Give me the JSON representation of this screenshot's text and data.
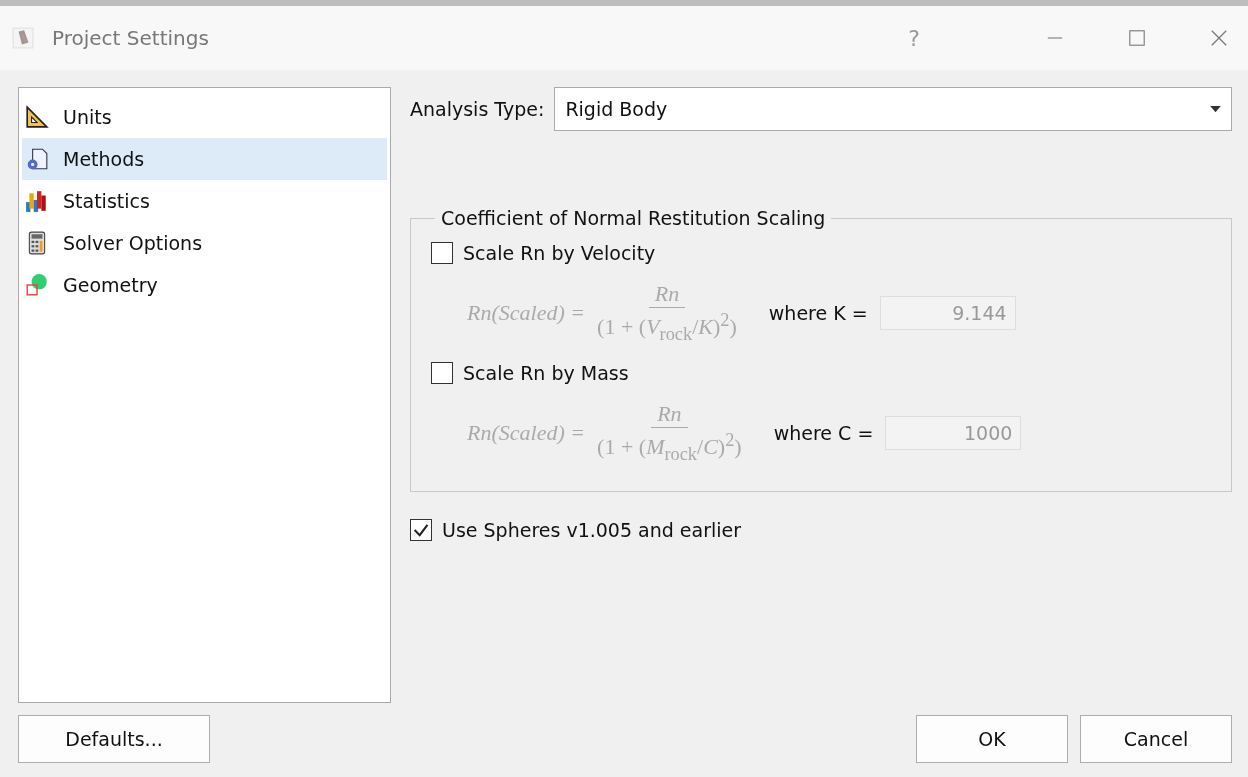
{
  "window": {
    "title": "Project Settings",
    "help": "?"
  },
  "sidebar": {
    "items": [
      {
        "label": "Units",
        "kind": "units",
        "selected": false
      },
      {
        "label": "Methods",
        "kind": "methods",
        "selected": true
      },
      {
        "label": "Statistics",
        "kind": "statistics",
        "selected": false
      },
      {
        "label": "Solver Options",
        "kind": "solver",
        "selected": false
      },
      {
        "label": "Geometry",
        "kind": "geometry",
        "selected": false
      }
    ]
  },
  "analysis_type": {
    "label": "Analysis Type:",
    "value": "Rigid Body"
  },
  "group": {
    "title": "Coefficient of Normal Restitution Scaling",
    "options": [
      {
        "label": "Scale Rn by Velocity",
        "checked": false,
        "lhs": "Rn(Scaled) =",
        "numerator": "Rn",
        "denominator": "(1 + (*V*$_{rock}$/*K*)$^{2}$)",
        "param_label": "where K =",
        "param_value": "9.144",
        "disabled": true
      },
      {
        "label": "Scale Rn by Mass",
        "checked": false,
        "lhs": "Rn(Scaled) =",
        "numerator": "Rn",
        "denominator": "(1 + (*M*$_{rock}$/*C*)$^{2}$)",
        "param_label": "where C =",
        "param_value": "1000",
        "disabled": true
      }
    ]
  },
  "legacy_option": {
    "label": "Use Spheres v1.005 and earlier",
    "checked": true
  },
  "buttons": {
    "defaults": "Defaults...",
    "ok": "OK",
    "cancel": "Cancel"
  }
}
